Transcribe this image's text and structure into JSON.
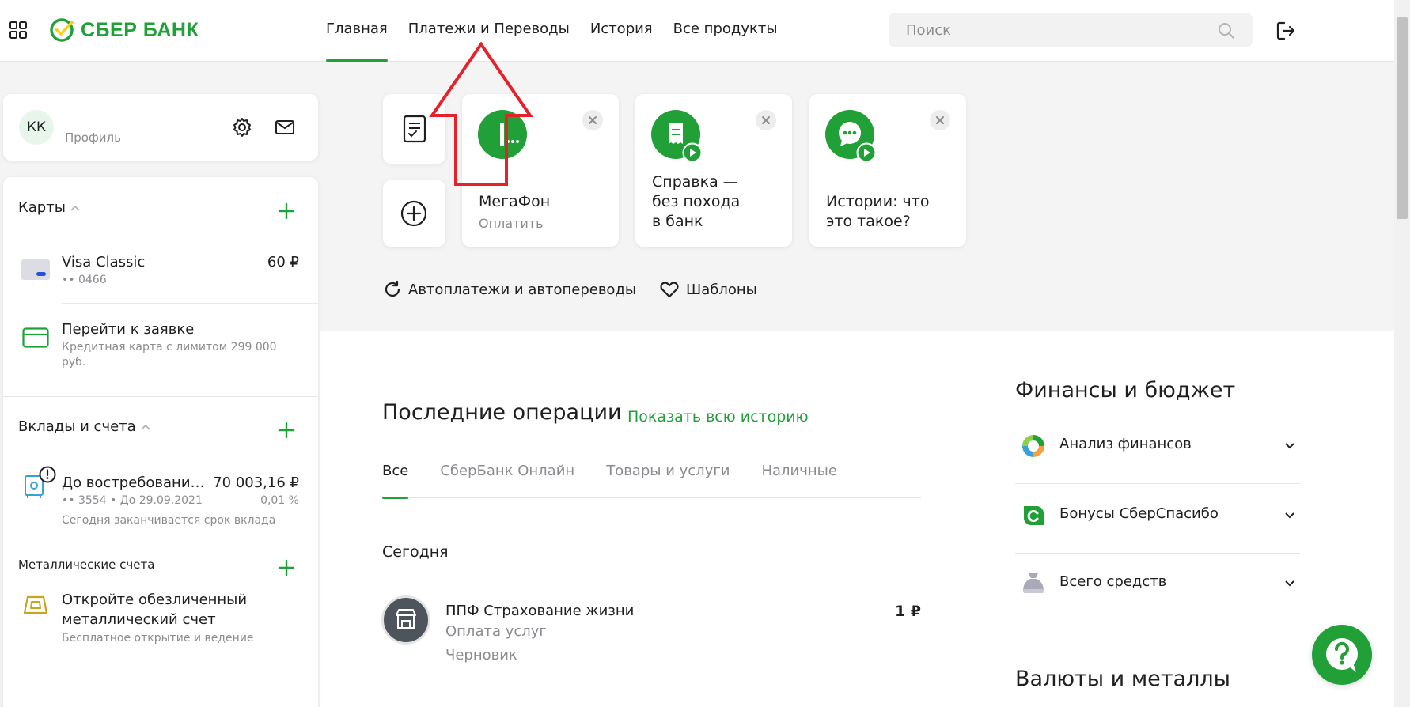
{
  "header": {
    "logo_text": "СБЕР БАНК",
    "nav": [
      "Главная",
      "Платежи и Переводы",
      "История",
      "Все продукты"
    ],
    "search_placeholder": "Поиск"
  },
  "profile": {
    "initials": "КК",
    "label": "Профиль"
  },
  "cards": {
    "title": "Карты",
    "items": [
      {
        "name": "Visa Classic",
        "number": "•• 0466",
        "amount": "60 ₽"
      },
      {
        "name": "Перейти к заявке",
        "sub": "Кредитная карта с лимитом 299 000 руб."
      }
    ]
  },
  "deposits": {
    "title": "Вклады и счета",
    "item": {
      "name": "До востребовани…",
      "amount": "70 003,16 ₽",
      "details": "•• 3554 • До 29.09.2021",
      "rate": "0,01 %",
      "note": "Сегодня заканчивается срок вклада"
    }
  },
  "metals": {
    "title": "Металлические счета",
    "item": {
      "name_line1": "Откройте обезличенный",
      "name_line2": "металлический счет",
      "sub": "Бесплатное открытие и ведение"
    }
  },
  "tiles": [
    {
      "title": "МегаФон",
      "sub": "Оплатить"
    },
    {
      "title_lines": [
        "Справка —",
        "без похода",
        "в банк"
      ]
    },
    {
      "title_lines": [
        "Истории: что",
        "это такое?"
      ]
    }
  ],
  "links": {
    "autopay": "Автоплатежи и автопереводы",
    "templates": "Шаблоны"
  },
  "operations": {
    "title": "Последние операции",
    "show_all": "Показать всю историю",
    "tabs": [
      "Все",
      "СберБанк Онлайн",
      "Товары и услуги",
      "Наличные"
    ],
    "group": "Сегодня",
    "items": [
      {
        "title": "ППФ Страхование жизни",
        "sub": "Оплата услуг",
        "status": "Черновик",
        "amount": "1 ₽"
      }
    ]
  },
  "finance": {
    "title": "Финансы и бюджет",
    "rows": [
      "Анализ финансов",
      "Бонусы СберСпасибо",
      "Всего средств"
    ]
  },
  "currencies": {
    "title": "Валюты и металлы"
  },
  "colors": {
    "brand": "#21a038",
    "annotation": "#e8202a"
  }
}
